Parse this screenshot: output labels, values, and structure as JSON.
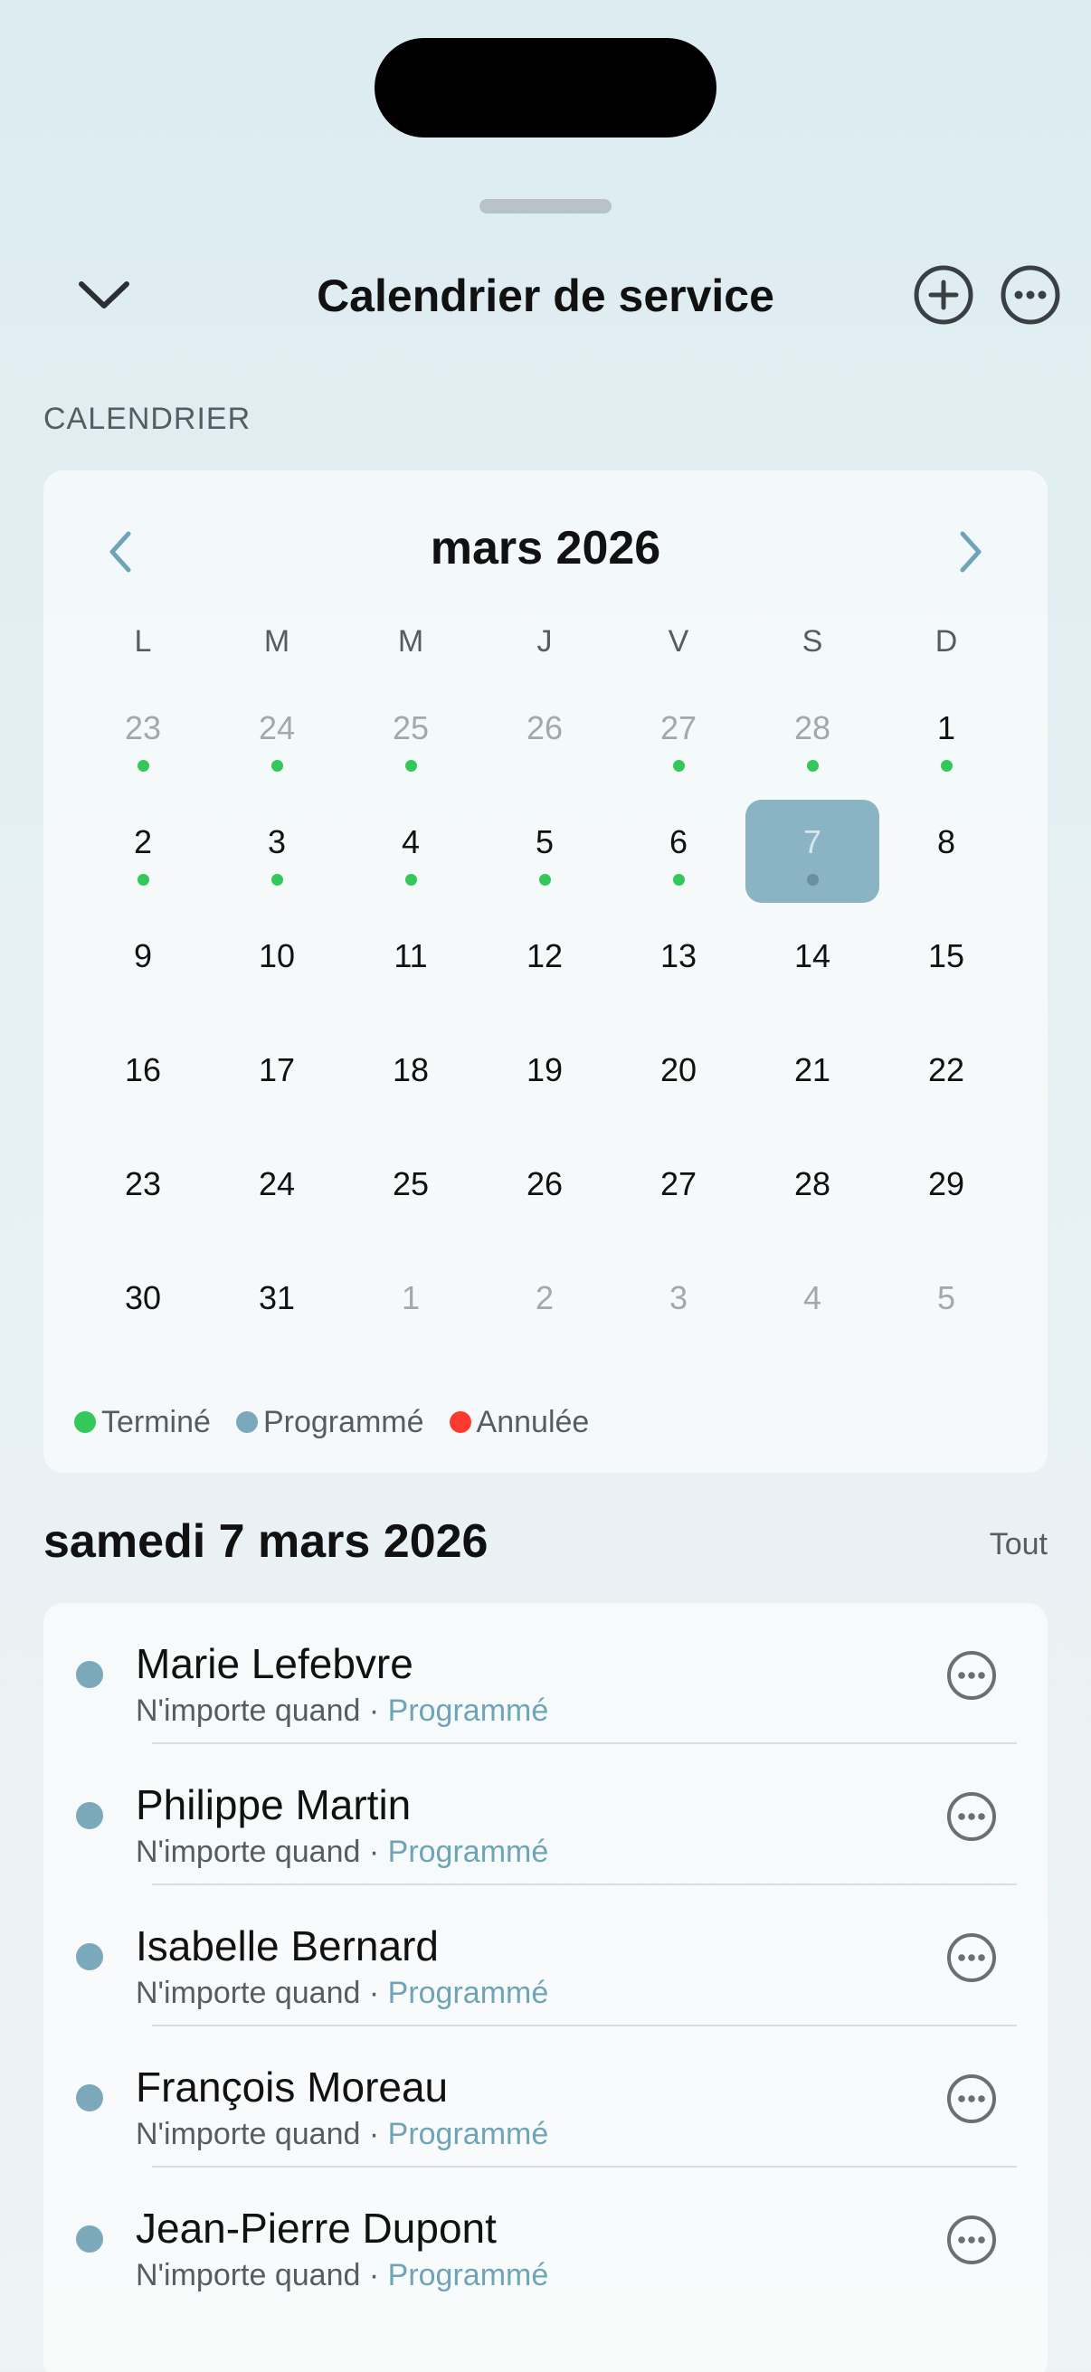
{
  "header": {
    "title": "Calendrier de service",
    "back_icon": "chevron-down-icon",
    "add_icon": "plus-circle-icon",
    "more_icon": "ellipsis-circle-icon"
  },
  "section_label": "CALENDRIER",
  "calendar": {
    "month_label": "mars 2026",
    "weekdays": [
      "L",
      "M",
      "M",
      "J",
      "V",
      "S",
      "D"
    ],
    "weeks": [
      [
        {
          "n": "23",
          "muted": true,
          "dot": true
        },
        {
          "n": "24",
          "muted": true,
          "dot": true
        },
        {
          "n": "25",
          "muted": true,
          "dot": true
        },
        {
          "n": "26",
          "muted": true,
          "dot": false
        },
        {
          "n": "27",
          "muted": true,
          "dot": true
        },
        {
          "n": "28",
          "muted": true,
          "dot": true
        },
        {
          "n": "1",
          "muted": false,
          "dot": true
        }
      ],
      [
        {
          "n": "2",
          "muted": false,
          "dot": true
        },
        {
          "n": "3",
          "muted": false,
          "dot": true
        },
        {
          "n": "4",
          "muted": false,
          "dot": true
        },
        {
          "n": "5",
          "muted": false,
          "dot": true
        },
        {
          "n": "6",
          "muted": false,
          "dot": true
        },
        {
          "n": "7",
          "muted": false,
          "dot": true,
          "selected": true
        },
        {
          "n": "8",
          "muted": false,
          "dot": false
        }
      ],
      [
        {
          "n": "9"
        },
        {
          "n": "10"
        },
        {
          "n": "11"
        },
        {
          "n": "12"
        },
        {
          "n": "13"
        },
        {
          "n": "14"
        },
        {
          "n": "15"
        }
      ],
      [
        {
          "n": "16"
        },
        {
          "n": "17"
        },
        {
          "n": "18"
        },
        {
          "n": "19"
        },
        {
          "n": "20"
        },
        {
          "n": "21"
        },
        {
          "n": "22"
        }
      ],
      [
        {
          "n": "23"
        },
        {
          "n": "24"
        },
        {
          "n": "25"
        },
        {
          "n": "26"
        },
        {
          "n": "27"
        },
        {
          "n": "28"
        },
        {
          "n": "29"
        }
      ],
      [
        {
          "n": "30"
        },
        {
          "n": "31"
        },
        {
          "n": "1",
          "muted": true
        },
        {
          "n": "2",
          "muted": true
        },
        {
          "n": "3",
          "muted": true
        },
        {
          "n": "4",
          "muted": true
        },
        {
          "n": "5",
          "muted": true
        }
      ]
    ],
    "legend": [
      {
        "label": "Terminé",
        "color": "#34c759"
      },
      {
        "label": "Programmé",
        "color": "#7ba9bb"
      },
      {
        "label": "Annulée",
        "color": "#ff3b30"
      }
    ]
  },
  "day_section": {
    "heading": "samedi 7 mars 2026",
    "see_all": "Tout"
  },
  "appointments": [
    {
      "name": "Marie Lefebvre",
      "time": "N'importe quand",
      "status": "Programmé"
    },
    {
      "name": "Philippe Martin",
      "time": "N'importe quand",
      "status": "Programmé"
    },
    {
      "name": "Isabelle Bernard",
      "time": "N'importe quand",
      "status": "Programmé"
    },
    {
      "name": "François Moreau",
      "time": "N'importe quand",
      "status": "Programmé"
    },
    {
      "name": "Jean-Pierre Dupont",
      "time": "N'importe quand",
      "status": "Programmé"
    }
  ],
  "colors": {
    "accent": "#7ba9bb",
    "selected_day": "#8ab4c4",
    "done": "#34c759",
    "cancelled": "#ff3b30"
  }
}
